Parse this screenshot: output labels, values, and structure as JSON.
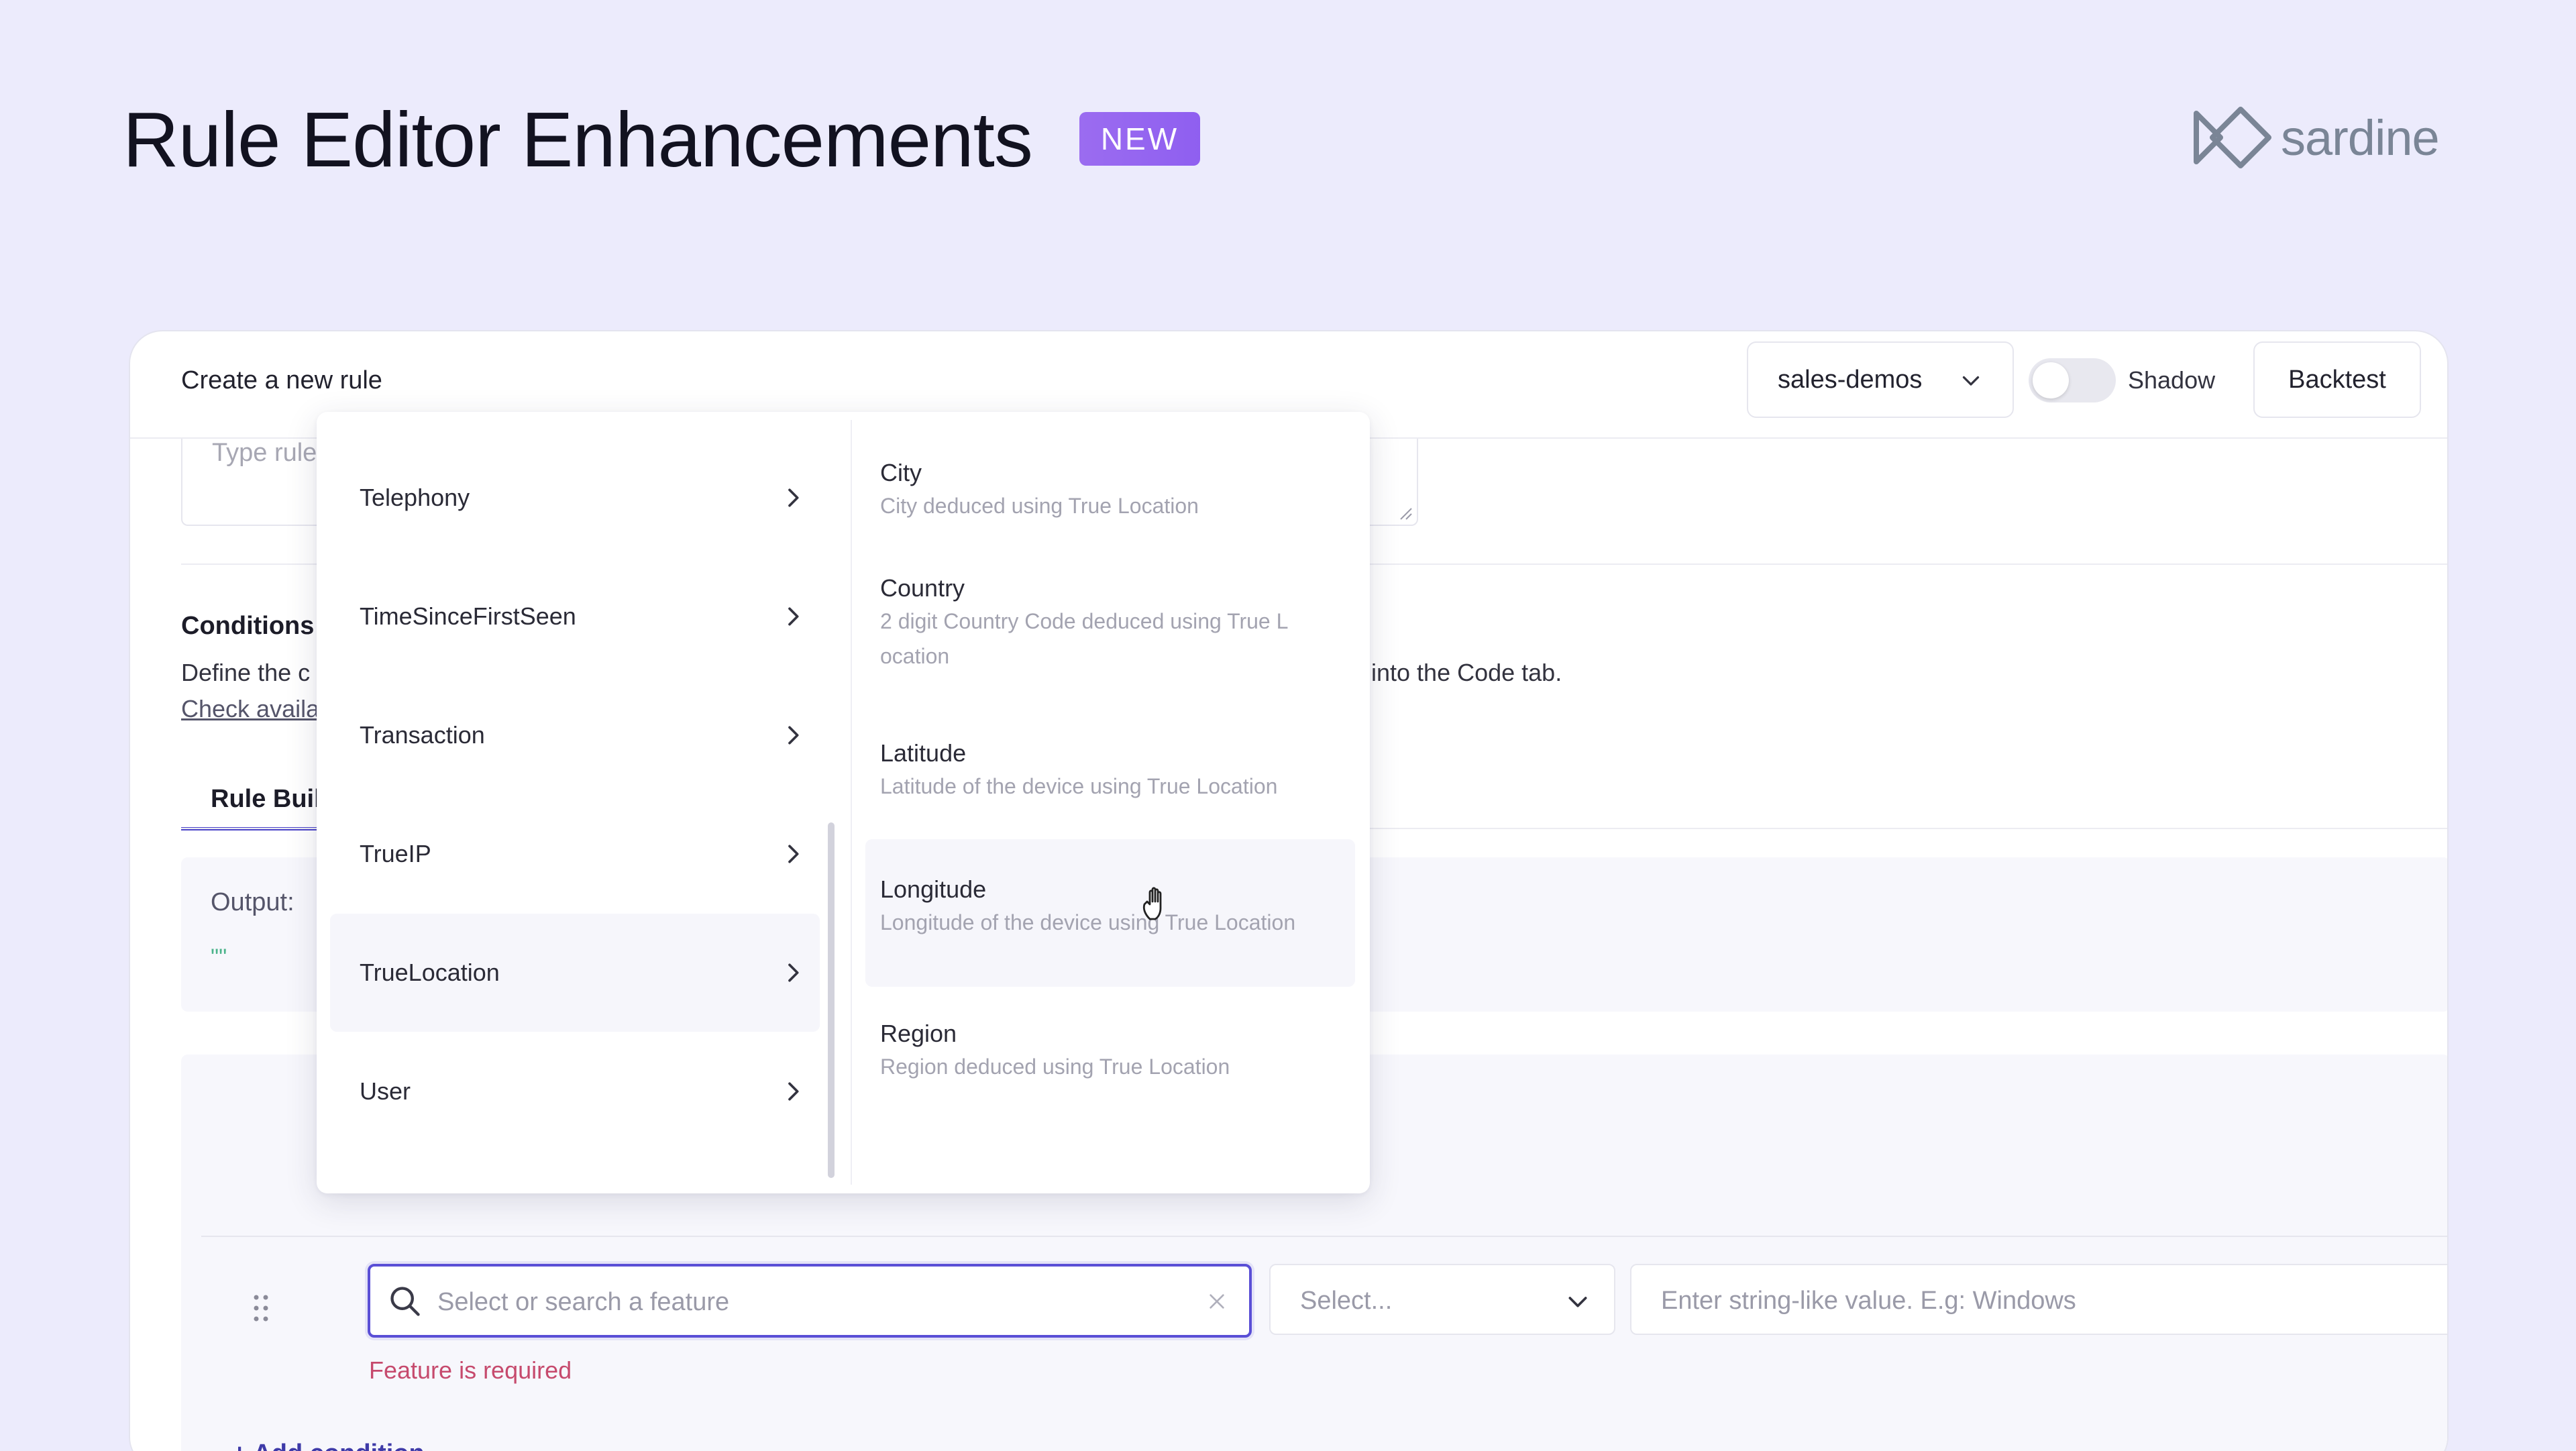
{
  "hero": {
    "title": "Rule Editor Enhancements",
    "badge": "NEW"
  },
  "logo": {
    "text": "sardine"
  },
  "header": {
    "title": "Create a new rule",
    "workspace": "sales-demos",
    "shadow_label": "Shadow",
    "shadow_enabled": false,
    "backtest_label": "Backtest"
  },
  "description": {
    "placeholder": "Type rule"
  },
  "conditions": {
    "title": "Conditions",
    "desc_left": "Define the c",
    "desc_right": "into the Code tab.",
    "link": "Check availa"
  },
  "tabs": {
    "rule_builder": "Rule Buil"
  },
  "output": {
    "label": "Output:",
    "value": "\"\""
  },
  "condition_row": {
    "feature_placeholder": "Select or search a feature",
    "operator_placeholder": "Select...",
    "value_placeholder": "Enter string-like value. E.g: Windows",
    "error": "Feature is required",
    "add_condition": "+ Add condition"
  },
  "dropdown": {
    "categories": [
      {
        "label": "Telephony"
      },
      {
        "label": "TimeSinceFirstSeen"
      },
      {
        "label": "Transaction"
      },
      {
        "label": "TrueIP"
      },
      {
        "label": "TrueLocation",
        "active": true
      },
      {
        "label": "User"
      }
    ],
    "features": [
      {
        "name": "City",
        "desc": "City deduced using True Location"
      },
      {
        "name": "Country",
        "desc": "2 digit Country Code deduced using True L",
        "desc2": "ocation"
      },
      {
        "name": "Latitude",
        "desc": "Latitude of the device using True Location"
      },
      {
        "name": "Longitude",
        "desc": "Longitude of the device using True Location",
        "hover": true
      },
      {
        "name": "Region",
        "desc": "Region deduced using True Location"
      }
    ]
  },
  "colors": {
    "background": "#ecebfc",
    "accent": "#5a4fd6",
    "badge": "#9b6cf0",
    "error": "#c64a6d",
    "link": "#3e3aa8"
  },
  "icons": [
    "sardine-logo-icon",
    "chevron-down-icon",
    "search-icon",
    "clear-icon",
    "chevron-right-icon",
    "drag-handle-icon",
    "hand-cursor-icon",
    "resize-handle-icon"
  ]
}
